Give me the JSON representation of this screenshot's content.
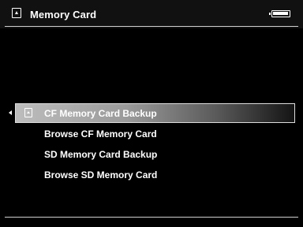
{
  "header": {
    "title": "Memory Card",
    "left_icon": "memory-card-icon",
    "right_icon": "battery-icon"
  },
  "menu": {
    "selected_index": 0,
    "items": [
      {
        "label": "CF Memory Card Backup",
        "icon": "memory-card-icon"
      },
      {
        "label": "Browse CF Memory Card"
      },
      {
        "label": "SD Memory Card Backup"
      },
      {
        "label": "Browse SD Memory Card"
      }
    ]
  }
}
